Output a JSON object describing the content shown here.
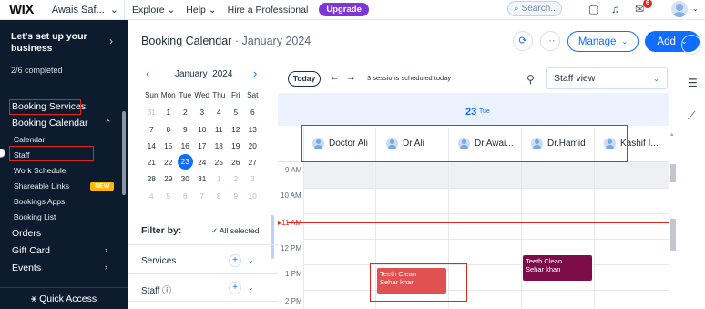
{
  "topbar": {
    "logo": "WIX",
    "site_name": "Awais Saf...",
    "nav": [
      "Explore",
      "Help",
      "Hire a Professional"
    ],
    "upgrade": "Upgrade",
    "search_placeholder": "Search...",
    "notification_count": "6"
  },
  "sidebar": {
    "setup_title": "Let's set up your business",
    "completed": "2/6 completed",
    "items": {
      "booking_services": "Booking Services",
      "booking_calendar": "Booking Calendar",
      "calendar": "Calendar",
      "staff": "Staff",
      "work_schedule": "Work Schedule",
      "shareable_links": "Shareable Links",
      "new_badge": "NEW",
      "bookings_apps": "Bookings Apps",
      "booking_list": "Booking List",
      "orders": "Orders",
      "gift_card": "Gift Card",
      "events": "Events"
    },
    "quick_access": "Quick Access"
  },
  "header": {
    "title": "Booking Calendar",
    "subtitle": "January 2024",
    "manage": "Manage",
    "add": "Add"
  },
  "mini_calendar": {
    "month": "January",
    "year": "2024",
    "weekdays": [
      "Sun",
      "Mon",
      "Tue",
      "Wed",
      "Thu",
      "Fri",
      "Sat"
    ],
    "weeks": [
      [
        "31",
        "1",
        "2",
        "3",
        "4",
        "5",
        "6"
      ],
      [
        "7",
        "8",
        "9",
        "10",
        "11",
        "12",
        "13"
      ],
      [
        "14",
        "15",
        "16",
        "17",
        "18",
        "19",
        "20"
      ],
      [
        "21",
        "22",
        "23",
        "24",
        "25",
        "26",
        "27"
      ],
      [
        "28",
        "29",
        "30",
        "31",
        "1",
        "2",
        "3"
      ],
      [
        "4",
        "5",
        "6",
        "7",
        "8",
        "9",
        "10"
      ]
    ],
    "selected": "23"
  },
  "filters": {
    "label": "Filter by:",
    "all_selected": "All selected",
    "services": "Services",
    "staff": "Staff"
  },
  "calendar": {
    "today": "Today",
    "sessions": "3 sessions scheduled today",
    "view": "Staff view",
    "day_number": "23",
    "day_name": "Tue",
    "staff": [
      "Doctor Ali",
      "Dr Ali",
      "Dr Awai...",
      "Dr.Hamid",
      "Kashif I..."
    ],
    "times": [
      "9 AM",
      "10 AM",
      "11 AM",
      "12 PM",
      "1 PM",
      "2 PM"
    ],
    "appointments": [
      {
        "title": "Teeth Clean",
        "client": "Sehar khan",
        "color": "#e05252"
      },
      {
        "title": "Teeth Clean",
        "client": "Sehar khan",
        "color": "#7d0c4a"
      }
    ]
  },
  "colors": {
    "accent": "#116dff",
    "sidebar_bg": "#0d1b2e",
    "upgrade": "#7f36d6",
    "highlight_box": "#e0261a"
  }
}
